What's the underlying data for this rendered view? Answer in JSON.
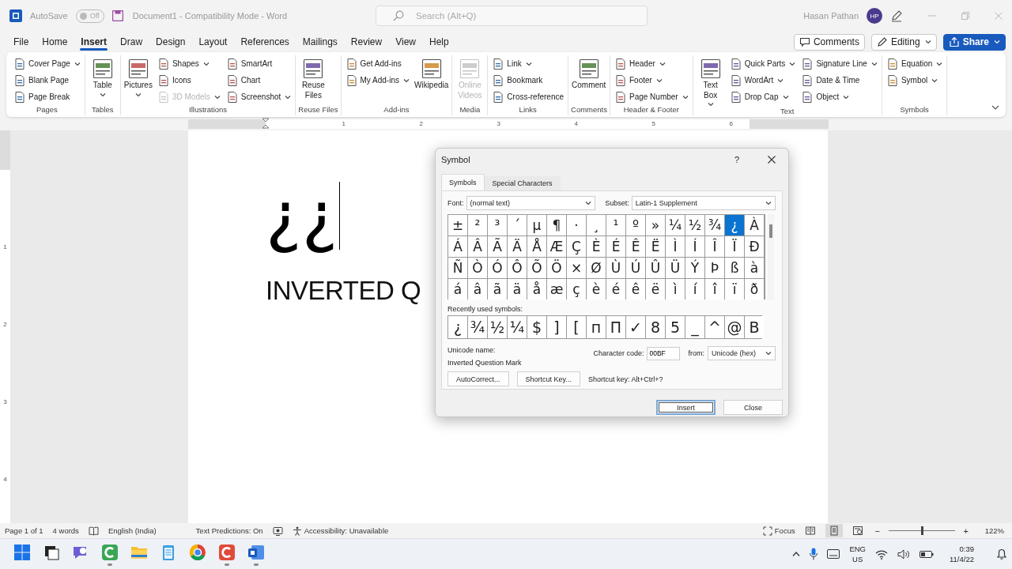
{
  "title_bar": {
    "autosave_label": "AutoSave",
    "autosave_state": "Off",
    "autosave_on": false,
    "document_title": "Document1  -  Compatibility Mode  -  Word",
    "search_placeholder": "Search (Alt+Q)",
    "user_name": "Hasan Pathan",
    "avatar": "HP"
  },
  "menu_tabs": [
    {
      "label": "File",
      "selected": false
    },
    {
      "label": "Home",
      "selected": false
    },
    {
      "label": "Insert",
      "selected": true
    },
    {
      "label": "Draw",
      "selected": false
    },
    {
      "label": "Design",
      "selected": false
    },
    {
      "label": "Layout",
      "selected": false
    },
    {
      "label": "References",
      "selected": false
    },
    {
      "label": "Mailings",
      "selected": false
    },
    {
      "label": "Review",
      "selected": false
    },
    {
      "label": "View",
      "selected": false
    },
    {
      "label": "Help",
      "selected": false
    }
  ],
  "menu_actions": {
    "comments": "Comments",
    "editing": "Editing",
    "share": "Share"
  },
  "ribbon": [
    {
      "label": "Pages",
      "columns": [
        [
          {
            "label": "Cover Page",
            "kind": "small",
            "dropdown": true
          },
          {
            "label": "Blank Page",
            "kind": "small"
          },
          {
            "label": "Page Break",
            "kind": "small"
          }
        ]
      ]
    },
    {
      "label": "Tables",
      "columns": [
        [
          {
            "label": "Table",
            "kind": "large",
            "dropdown": true
          }
        ]
      ]
    },
    {
      "label": "Illustrations",
      "columns": [
        [
          {
            "label": "Pictures",
            "kind": "large",
            "dropdown": true
          }
        ],
        [
          {
            "label": "Shapes",
            "kind": "small",
            "dropdown": true
          },
          {
            "label": "Icons",
            "kind": "small"
          },
          {
            "label": "3D Models",
            "kind": "small",
            "dropdown": true,
            "disabled": true
          }
        ],
        [
          {
            "label": "SmartArt",
            "kind": "small"
          },
          {
            "label": "Chart",
            "kind": "small"
          },
          {
            "label": "Screenshot",
            "kind": "small",
            "dropdown": true
          }
        ]
      ]
    },
    {
      "label": "Reuse Files",
      "columns": [
        [
          {
            "label": "Reuse Files",
            "kind": "large"
          }
        ]
      ]
    },
    {
      "label": "Add-ins",
      "columns": [
        [
          {
            "label": "Get Add-ins",
            "kind": "small"
          },
          {
            "label": "My Add-ins",
            "kind": "small",
            "dropdown": true
          }
        ],
        [
          {
            "label": "Wikipedia",
            "kind": "large"
          }
        ]
      ]
    },
    {
      "label": "Media",
      "columns": [
        [
          {
            "label": "Online Videos",
            "kind": "large",
            "disabled": true
          }
        ]
      ]
    },
    {
      "label": "Links",
      "columns": [
        [
          {
            "label": "Link",
            "kind": "small",
            "dropdown": true
          },
          {
            "label": "Bookmark",
            "kind": "small"
          },
          {
            "label": "Cross-reference",
            "kind": "small"
          }
        ]
      ]
    },
    {
      "label": "Comments",
      "columns": [
        [
          {
            "label": "Comment",
            "kind": "large"
          }
        ]
      ]
    },
    {
      "label": "Header & Footer",
      "columns": [
        [
          {
            "label": "Header",
            "kind": "small",
            "dropdown": true
          },
          {
            "label": "Footer",
            "kind": "small",
            "dropdown": true
          },
          {
            "label": "Page Number",
            "kind": "small",
            "dropdown": true
          }
        ]
      ]
    },
    {
      "label": "Text",
      "columns": [
        [
          {
            "label": "Text Box",
            "kind": "large",
            "dropdown": true
          }
        ],
        [
          {
            "label": "Quick Parts",
            "kind": "small",
            "dropdown": true
          },
          {
            "label": "WordArt",
            "kind": "small",
            "dropdown": true
          },
          {
            "label": "Drop Cap",
            "kind": "small",
            "dropdown": true
          }
        ],
        [
          {
            "label": "Signature Line",
            "kind": "small",
            "dropdown": true
          },
          {
            "label": "Date & Time",
            "kind": "small"
          },
          {
            "label": "Object",
            "kind": "small",
            "dropdown": true
          }
        ]
      ]
    },
    {
      "label": "Symbols",
      "columns": [
        [
          {
            "label": "Equation",
            "kind": "small",
            "dropdown": true
          },
          {
            "label": "Symbol",
            "kind": "small",
            "dropdown": true
          }
        ]
      ]
    }
  ],
  "horizontal_ruler": [
    "1",
    "2",
    "3",
    "4",
    "5",
    "6"
  ],
  "vertical_ruler": [
    "1",
    "2",
    "3",
    "4"
  ],
  "document": {
    "symbols": "¿¿",
    "heading": "INVERTED Q"
  },
  "symbol_dialog": {
    "title": "Symbol",
    "help": "?",
    "tabs": [
      {
        "label": "Symbols",
        "selected": true
      },
      {
        "label": "Special Characters",
        "selected": false
      }
    ],
    "font_label": "Font:",
    "font_value": "(normal text)",
    "subset_label": "Subset:",
    "subset_value": "Latin-1 Supplement",
    "symbols": [
      {
        "char": "±",
        "selected": false
      },
      {
        "char": "²",
        "selected": false
      },
      {
        "char": "³",
        "selected": false
      },
      {
        "char": "´",
        "selected": false
      },
      {
        "char": "µ",
        "selected": false
      },
      {
        "char": "¶",
        "selected": false
      },
      {
        "char": "·",
        "selected": false
      },
      {
        "char": "¸",
        "selected": false
      },
      {
        "char": "¹",
        "selected": false
      },
      {
        "char": "º",
        "selected": false
      },
      {
        "char": "»",
        "selected": false
      },
      {
        "char": "¼",
        "selected": false
      },
      {
        "char": "½",
        "selected": false
      },
      {
        "char": "¾",
        "selected": false
      },
      {
        "char": "¿",
        "selected": true
      },
      {
        "char": "À",
        "selected": false
      },
      {
        "char": "Á",
        "selected": false
      },
      {
        "char": "Â",
        "selected": false
      },
      {
        "char": "Ã",
        "selected": false
      },
      {
        "char": "Ä",
        "selected": false
      },
      {
        "char": "Å",
        "selected": false
      },
      {
        "char": "Æ",
        "selected": false
      },
      {
        "char": "Ç",
        "selected": false
      },
      {
        "char": "È",
        "selected": false
      },
      {
        "char": "É",
        "selected": false
      },
      {
        "char": "Ê",
        "selected": false
      },
      {
        "char": "Ë",
        "selected": false
      },
      {
        "char": "Ì",
        "selected": false
      },
      {
        "char": "Í",
        "selected": false
      },
      {
        "char": "Î",
        "selected": false
      },
      {
        "char": "Ï",
        "selected": false
      },
      {
        "char": "Ð",
        "selected": false
      },
      {
        "char": "Ñ",
        "selected": false
      },
      {
        "char": "Ò",
        "selected": false
      },
      {
        "char": "Ó",
        "selected": false
      },
      {
        "char": "Ô",
        "selected": false
      },
      {
        "char": "Õ",
        "selected": false
      },
      {
        "char": "Ö",
        "selected": false
      },
      {
        "char": "×",
        "selected": false
      },
      {
        "char": "Ø",
        "selected": false
      },
      {
        "char": "Ù",
        "selected": false
      },
      {
        "char": "Ú",
        "selected": false
      },
      {
        "char": "Û",
        "selected": false
      },
      {
        "char": "Ü",
        "selected": false
      },
      {
        "char": "Ý",
        "selected": false
      },
      {
        "char": "Þ",
        "selected": false
      },
      {
        "char": "ß",
        "selected": false
      },
      {
        "char": "à",
        "selected": false
      },
      {
        "char": "á",
        "selected": false
      },
      {
        "char": "â",
        "selected": false
      },
      {
        "char": "ã",
        "selected": false
      },
      {
        "char": "ä",
        "selected": false
      },
      {
        "char": "å",
        "selected": false
      },
      {
        "char": "æ",
        "selected": false
      },
      {
        "char": "ç",
        "selected": false
      },
      {
        "char": "è",
        "selected": false
      },
      {
        "char": "é",
        "selected": false
      },
      {
        "char": "ê",
        "selected": false
      },
      {
        "char": "ë",
        "selected": false
      },
      {
        "char": "ì",
        "selected": false
      },
      {
        "char": "í",
        "selected": false
      },
      {
        "char": "î",
        "selected": false
      },
      {
        "char": "ï",
        "selected": false
      },
      {
        "char": "ð",
        "selected": false
      }
    ],
    "recent_label": "Recently used symbols:",
    "recent": [
      "¿",
      "¾",
      "½",
      "¼",
      "$",
      "]",
      "[",
      "п",
      "П",
      "✓",
      "8",
      "5",
      "_",
      "^",
      "@",
      "B"
    ],
    "unicode_name_label": "Unicode name:",
    "unicode_name": "Inverted Question Mark",
    "code_label": "Character code:",
    "code_value": "00BF",
    "from_label": "from:",
    "from_value": "Unicode (hex)",
    "buttons": [
      "AutoCorrect...",
      "Shortcut Key..."
    ],
    "shortcut_text": "Shortcut key: Alt+Ctrl+?",
    "footer_buttons": [
      {
        "label": "Insert",
        "default": true
      },
      {
        "label": "Close",
        "default": false
      }
    ]
  },
  "status_bar": {
    "page": "Page 1 of 1",
    "words": "4 words",
    "language": "English (India)",
    "predictions": "Text Predictions: On",
    "accessibility": "Accessibility: Unavailable",
    "focus": "Focus",
    "views": [
      {
        "selected": false
      },
      {
        "selected": true
      },
      {
        "selected": false
      }
    ],
    "zoom_out": "−",
    "zoom_in": "+",
    "zoom": {
      "level": 0.5,
      "reading": "122%"
    }
  },
  "taskbar": {
    "apps": [
      {
        "kind": "start",
        "running": false
      },
      {
        "kind": "taskview",
        "running": false
      },
      {
        "kind": "chat",
        "running": false
      },
      {
        "kind": "greenapp",
        "running": true
      },
      {
        "kind": "folder",
        "running": false
      },
      {
        "kind": "notepad",
        "running": false
      },
      {
        "kind": "browser",
        "running": false
      },
      {
        "kind": "redapp",
        "running": true
      },
      {
        "kind": "word",
        "running": true
      }
    ],
    "language": "ENG",
    "region": "US",
    "time": "0:39",
    "date": "11/4/22"
  }
}
